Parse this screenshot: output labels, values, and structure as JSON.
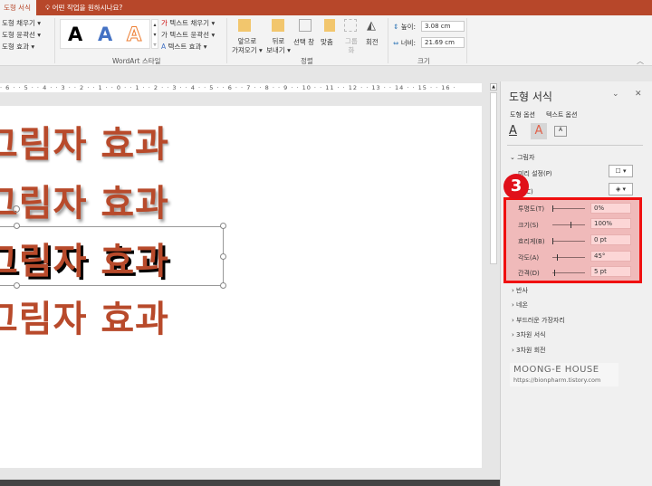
{
  "title_bar": {
    "active_tab": "도형 서식",
    "tell_me": "어떤 작업을 원하시나요?"
  },
  "ribbon": {
    "shape_styles": {
      "fill": "도형 채우기",
      "outline": "도형 윤곽선",
      "effects": "도형 효과"
    },
    "wordart": {
      "label": "WordArt 스타일",
      "samples": [
        "A",
        "A",
        "A"
      ],
      "text_fill": "텍스트 채우기",
      "text_outline": "텍스트 윤곽선",
      "text_effects": "텍스트 효과"
    },
    "arrange": {
      "label": "정렬",
      "bring_forward": [
        "앞으로",
        "가져오기"
      ],
      "send_backward": [
        "뒤로",
        "보내기"
      ],
      "selection_pane": "선택 창",
      "align": "맞춤",
      "group": [
        "그룹",
        "화"
      ],
      "rotate": "회전"
    },
    "size": {
      "label": "크기",
      "height_label": "높이:",
      "height": "3.08 cm",
      "width_label": "너비:",
      "width": "21.69 cm"
    }
  },
  "ruler": "· 6 · · 5 · · 4 · · 3 · · 2 · · 1 · · 0 · · 1 · · 2 · · 3 · · 4 · · 5 · · 6 · · 7 · · 8 · · 9 · · 10 · · 11 · · 12 · · 13 · · 14 · · 15 · · 16 ·",
  "slide": {
    "lines": [
      "그림자 효과",
      "그림자 효과",
      "그림자 효과",
      "그림자 효과"
    ]
  },
  "pane": {
    "title": "도형 서식",
    "tab_shape": "도형 옵션",
    "tab_text": "텍스트 옵션",
    "section_shadow": "그림자",
    "preset": "미리 설정(P)",
    "color": "색(C)",
    "props": [
      {
        "label": "투명도(T)",
        "value": "0%",
        "level": 0
      },
      {
        "label": "크기(S)",
        "value": "100%",
        "level": 0.55
      },
      {
        "label": "흐리게(B)",
        "value": "0 pt",
        "level": 0
      },
      {
        "label": "각도(A)",
        "value": "45°",
        "level": 0.125
      },
      {
        "label": "간격(D)",
        "value": "5 pt",
        "level": 0.05
      }
    ],
    "sections": [
      "반사",
      "네온",
      "부드러운 가장자리",
      "3차원 서식",
      "3차원 회전"
    ],
    "step_badge": "3"
  },
  "watermark": {
    "title": "MOONG-E HOUSE",
    "url": "https://bionpharm.tistory.com"
  }
}
